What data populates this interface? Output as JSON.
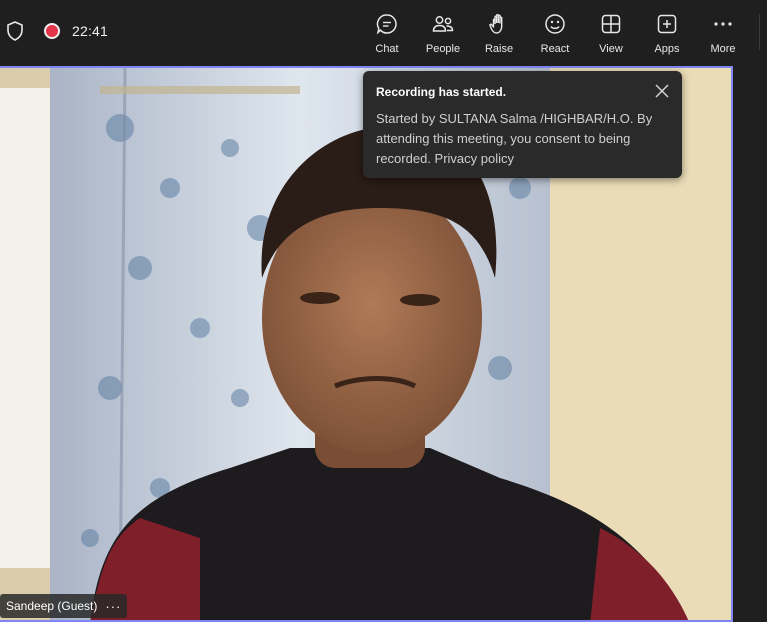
{
  "status": {
    "time": "22:41",
    "recording_color": "#e5344a"
  },
  "toolbar": {
    "items": [
      {
        "label": "Chat",
        "icon": "chat-icon"
      },
      {
        "label": "People",
        "icon": "people-icon"
      },
      {
        "label": "Raise",
        "icon": "hand-icon"
      },
      {
        "label": "React",
        "icon": "smiley-icon"
      },
      {
        "label": "View",
        "icon": "grid-icon"
      },
      {
        "label": "Apps",
        "icon": "plus-square-icon"
      },
      {
        "label": "More",
        "icon": "ellipsis-icon"
      }
    ]
  },
  "toast": {
    "title": "Recording has started.",
    "body": "Started by SULTANA Salma /HIGHBAR/H.O. By attending this meeting, you consent to being recorded. Privacy policy"
  },
  "participant": {
    "name": "Sandeep (Guest)",
    "more": "···"
  },
  "colors": {
    "accent_border": "#7f85f5",
    "background": "#1f1f1f"
  }
}
